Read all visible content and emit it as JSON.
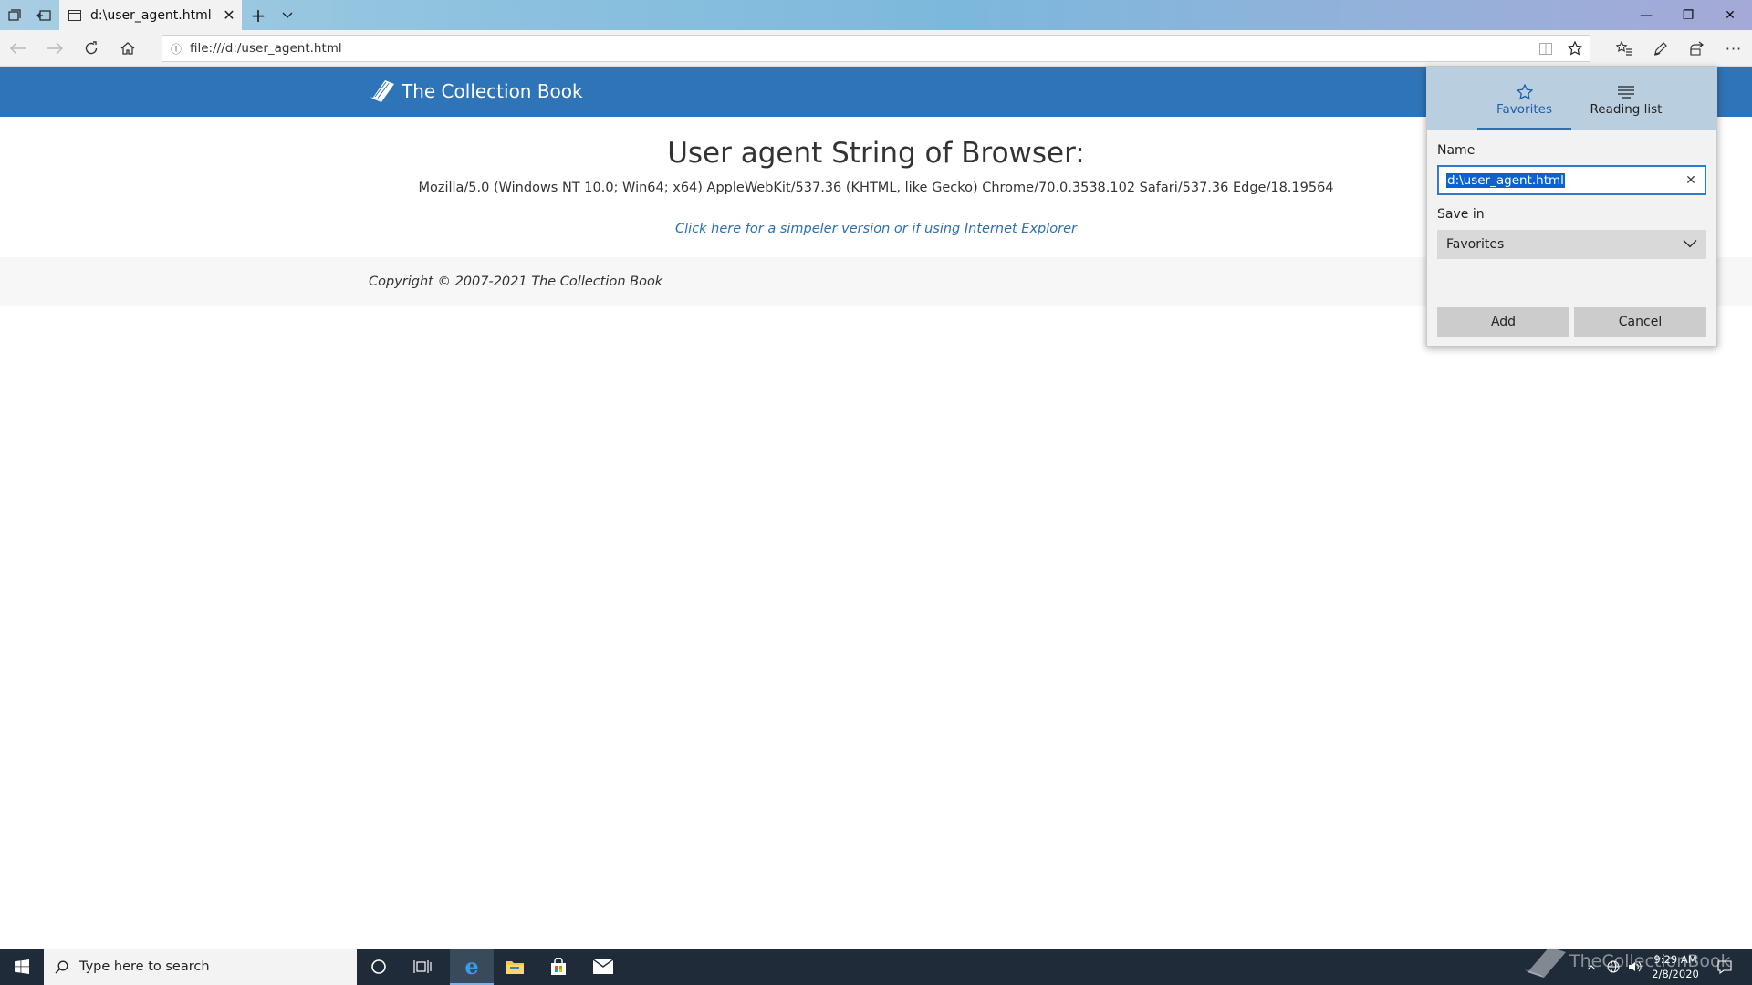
{
  "browser": {
    "tab": {
      "title": "d:\\user_agent.html"
    },
    "address": {
      "url": "file:///d:/user_agent.html"
    },
    "window_controls": {
      "minimize": "—",
      "restore": "❐",
      "close": "✕"
    }
  },
  "page": {
    "brand": "The Collection Book",
    "heading": "User agent String of Browser:",
    "user_agent": "Mozilla/5.0 (Windows NT 10.0; Win64; x64) AppleWebKit/537.36 (KHTML, like Gecko) Chrome/70.0.3538.102 Safari/537.36 Edge/18.19564",
    "simple_link": "Click here for a simpeler version or if using Internet Explorer",
    "copyright": "Copyright © 2007-2021 The Collection Book"
  },
  "favorites_panel": {
    "tabs": [
      {
        "label": "Favorites",
        "icon": "star-icon",
        "active": true
      },
      {
        "label": "Reading list",
        "icon": "reading-list-icon",
        "active": false
      }
    ],
    "name_label": "Name",
    "name_value": "d:\\user_agent.html",
    "save_in_label": "Save in",
    "save_in_value": "Favorites",
    "add_label": "Add",
    "cancel_label": "Cancel"
  },
  "taskbar": {
    "search_placeholder": "Type here to search",
    "clock_time": "9:29 AM",
    "clock_date": "2/8/2020",
    "watermark": "TheCollectionBook"
  },
  "colors": {
    "header_blue": "#2e74b8",
    "link_blue": "#2e6fb2",
    "selection_blue": "#0a63d1",
    "taskbar": "#1f2b39"
  }
}
